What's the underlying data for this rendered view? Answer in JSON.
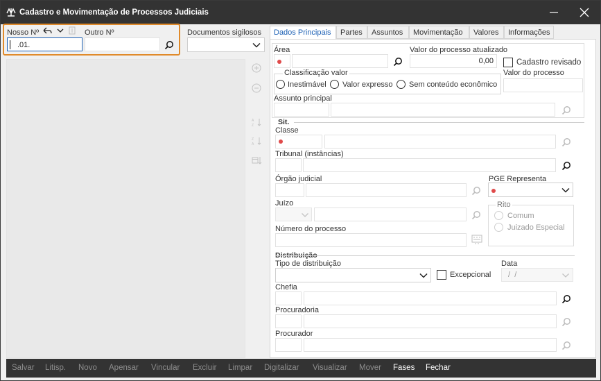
{
  "window": {
    "title": "Cadastro e Movimentação de Processos Judiciais",
    "icons": {
      "app": "scales-icon",
      "minimize": "minimize-icon",
      "close": "close-icon"
    }
  },
  "top": {
    "nosso_label": "Nosso Nº",
    "nosso_value": ".01.",
    "outro_label": "Outro Nº",
    "outro_value": "",
    "docs_label": "Documentos sigilosos",
    "docs_value": ""
  },
  "tabs": [
    {
      "label": "Dados Principais",
      "active": true
    },
    {
      "label": "Partes"
    },
    {
      "label": "Assuntos"
    },
    {
      "label": "Movimentação"
    },
    {
      "label": "Valores"
    },
    {
      "label": "Informações"
    }
  ],
  "principal": {
    "area_label": "Área",
    "valor_atual_label": "Valor do processo atualizado",
    "valor_atual_value": "0,00",
    "cadastro_revisado_label": "Cadastro revisado",
    "classificacao_label": "Classificação valor",
    "radio_inestimavel": "Inestimável",
    "radio_valor_expresso": "Valor expresso",
    "radio_sem_conteudo": "Sem conteúdo econômico",
    "valor_processo_label": "Valor do processo",
    "assunto_label": "Assunto principal"
  },
  "sit": {
    "section_label": "Sit.",
    "classe_label": "Classe",
    "tribunal_label": "Tribunal (instâncias)",
    "orgao_label": "Órgão judicial",
    "pge_label": "PGE Representa",
    "juizo_label": "Juízo",
    "rito_label": "Rito",
    "rito_comum": "Comum",
    "rito_juizado": "Juizado Especial",
    "numero_label": "Número do processo"
  },
  "distribuicao": {
    "section_label": "Distribuição",
    "tipo_label": "Tipo de distribuição",
    "excepcional_label": "Excepcional",
    "data_label": "Data",
    "data_value": " /  /",
    "chefia_label": "Chefia",
    "procuradoria_label": "Procuradoria",
    "procurador_label": "Procurador"
  },
  "bottom_buttons": [
    {
      "label": "Salvar",
      "enabled": false
    },
    {
      "label": "Litisp.",
      "enabled": false
    },
    {
      "label": "Novo",
      "enabled": false
    },
    {
      "label": "Apensar",
      "enabled": false
    },
    {
      "label": "Vincular",
      "enabled": false
    },
    {
      "label": "Excluir",
      "enabled": false
    },
    {
      "label": "Limpar",
      "enabled": false
    },
    {
      "label": "Digitalizar",
      "enabled": false
    },
    {
      "label": "Visualizar",
      "enabled": false
    },
    {
      "label": "Mover",
      "enabled": false
    },
    {
      "label": "Fases",
      "enabled": true
    },
    {
      "label": "Fechar",
      "enabled": true
    }
  ],
  "colors": {
    "titlebar": "#333333",
    "accent": "#1a5fb4",
    "highlight": "#e08a2a",
    "required": "#e04a4a"
  }
}
